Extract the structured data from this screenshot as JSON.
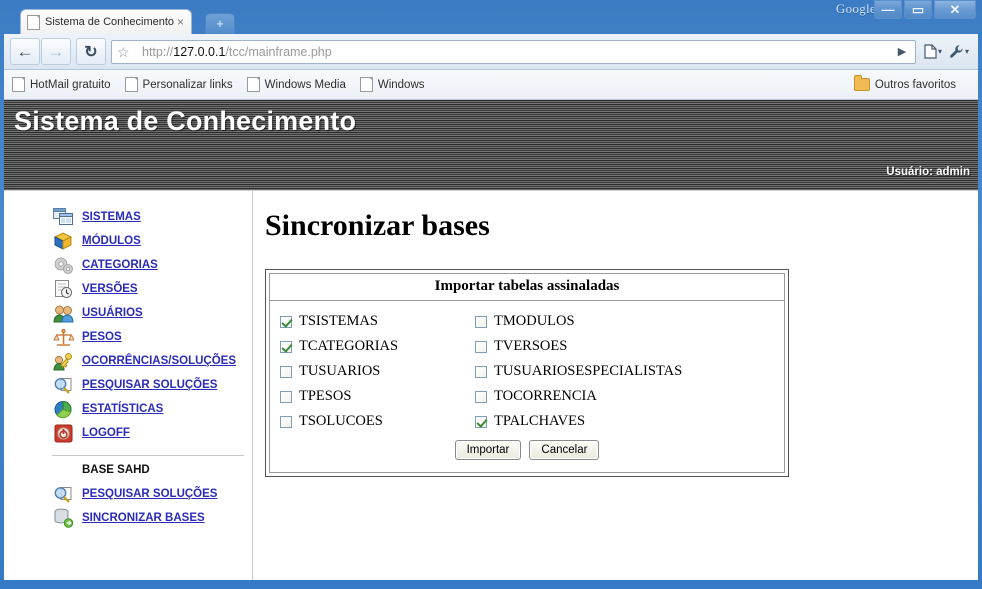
{
  "browser": {
    "tab_title": "Sistema de Conhecimento",
    "tab_close": "×",
    "new_tab": "+",
    "google_label": "Google",
    "window_minimize": "—",
    "window_maximize": "▭",
    "window_close": "✕",
    "back": "←",
    "forward": "→",
    "reload": "↻",
    "star": "☆",
    "go": "▶",
    "page_menu": "▾",
    "wrench_menu": "▾",
    "url_scheme": "http://",
    "url_host": "127.0.0.1",
    "url_path": "/tcc/mainframe.php",
    "bookmarks": [
      {
        "label": "HotMail gratuito"
      },
      {
        "label": "Personalizar links"
      },
      {
        "label": "Windows Media"
      },
      {
        "label": "Windows"
      }
    ],
    "other_bookmarks": "Outros favoritos"
  },
  "site": {
    "title": "Sistema de Conhecimento",
    "user": "Usuário: admin"
  },
  "sidebar": {
    "items": [
      {
        "label": "SISTEMAS",
        "icon": "windows-icon"
      },
      {
        "label": "MÓDULOS",
        "icon": "box-icon"
      },
      {
        "label": "CATEGORIAS",
        "icon": "gears-icon"
      },
      {
        "label": "VERSÕES",
        "icon": "document-clock-icon"
      },
      {
        "label": "USUÁRIOS",
        "icon": "users-icon"
      },
      {
        "label": "PESOS",
        "icon": "scales-icon"
      },
      {
        "label": "OCORRÊNCIAS/SOLUÇÕES",
        "icon": "person-key-icon"
      },
      {
        "label": "PESQUISAR SOLUÇÕES",
        "icon": "magnifier-icon"
      },
      {
        "label": "ESTATÍSTICAS",
        "icon": "pie-chart-icon"
      },
      {
        "label": "LOGOFF",
        "icon": "power-icon"
      }
    ],
    "group_title": "BASE SAHD",
    "group_items": [
      {
        "label": "PESQUISAR SOLUÇÕES",
        "icon": "magnifier-icon"
      },
      {
        "label": "SINCRONIZAR BASES",
        "icon": "database-sync-icon"
      }
    ]
  },
  "main": {
    "page_title": "Sincronizar bases",
    "panel_header": "Importar tabelas assinaladas",
    "checkboxes": [
      {
        "label": "TSISTEMAS",
        "checked": true
      },
      {
        "label": "TMODULOS",
        "checked": false
      },
      {
        "label": "TCATEGORIAS",
        "checked": true
      },
      {
        "label": "TVERSOES",
        "checked": false
      },
      {
        "label": "TUSUARIOS",
        "checked": false
      },
      {
        "label": "TUSUARIOSESPECIALISTAS",
        "checked": false
      },
      {
        "label": "TPESOS",
        "checked": false
      },
      {
        "label": "TOCORRENCIA",
        "checked": false
      },
      {
        "label": "TSOLUCOES",
        "checked": false
      },
      {
        "label": "TPALCHAVES",
        "checked": true
      }
    ],
    "import_button": "Importar",
    "cancel_button": "Cancelar"
  },
  "colors": {
    "link": "#2b2bbb",
    "window_frame": "#4a89cf",
    "banner_dark": "#2c2c2c",
    "check_green": "#3a8a3a"
  }
}
